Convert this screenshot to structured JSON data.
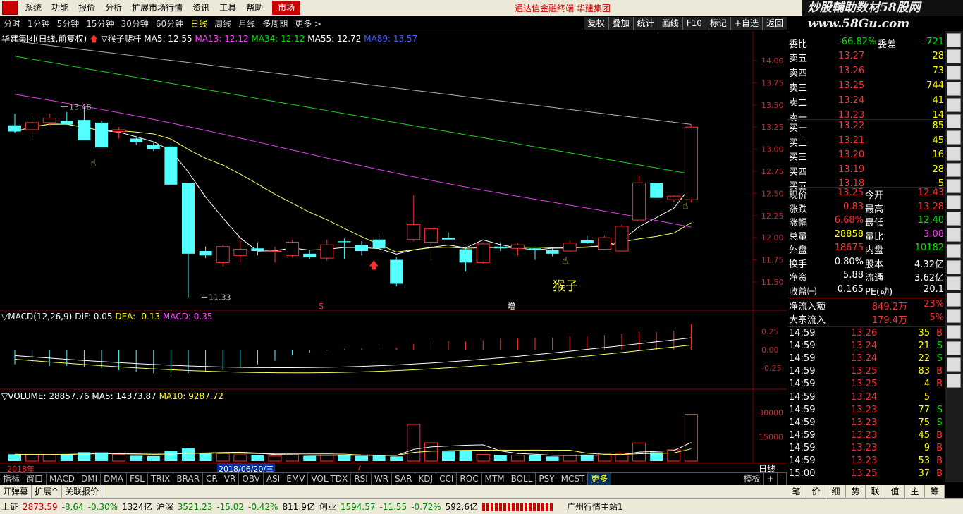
{
  "menu": {
    "items": [
      "系统",
      "功能",
      "报价",
      "分析",
      "扩展市场行情",
      "资讯",
      "工具",
      "帮助"
    ],
    "market": "市场",
    "center_title": "通达信金融终端 华建集团",
    "watermark": "炒股輔助数材58股网 www.58Gu.com"
  },
  "toolbar": {
    "periods": [
      "分时",
      "1分钟",
      "5分钟",
      "15分钟",
      "30分钟",
      "60分钟",
      "日线",
      "周线",
      "月线",
      "多周期",
      "更多 >"
    ],
    "active": "日线",
    "right_buttons": [
      "复权",
      "叠加",
      "统计",
      "画线",
      "F10",
      "标记",
      "+自选",
      "返回"
    ]
  },
  "info": {
    "title": "华建集团(日线,前复权)",
    "indicator": "▽猴子爬杆",
    "ma5": "MA5: 12.55",
    "ma13": "MA13: 12.12",
    "ma34": "MA34: 12.12",
    "ma55": "MA55: 12.72",
    "ma89": "MA89: 13.57"
  },
  "price_axis": [
    "14.00",
    "13.75",
    "13.50",
    "13.25",
    "13.00",
    "12.75",
    "12.50",
    "12.25",
    "12.00",
    "11.75",
    "11.50"
  ],
  "annotations": {
    "high": "13.48",
    "low": "11.33",
    "monkey": "猴子",
    "s_mark": "S",
    "add_mark": "增"
  },
  "macd": {
    "label": "▽MACD(12,26,9)",
    "dif": "DIF: 0.05",
    "dea": "DEA: -0.13",
    "macd": "MACD: 0.35",
    "axis": [
      "0.25",
      "0.00",
      "-0.25"
    ]
  },
  "volume": {
    "label": "▽VOLUME: 28857.76",
    "ma5": "MA5: 14373.87",
    "ma10": "MA10: 9287.72",
    "axis": [
      "30000",
      "15000"
    ]
  },
  "dates": {
    "year": "2018年",
    "cursor": "2018/06/20/三",
    "month": "7",
    "period_btn": "日线"
  },
  "chart_data": {
    "type": "candlestick",
    "ohlc": [
      [
        13.27,
        13.4,
        13.18,
        13.2
      ],
      [
        13.22,
        13.38,
        13.1,
        13.3
      ],
      [
        13.3,
        13.4,
        13.27,
        13.35
      ],
      [
        13.32,
        13.42,
        13.28,
        13.28
      ],
      [
        13.33,
        13.48,
        13.1,
        13.1
      ],
      [
        13.3,
        13.32,
        13.02,
        13.02
      ],
      [
        13.2,
        13.25,
        13.12,
        13.22
      ],
      [
        13.12,
        13.15,
        13.05,
        13.08
      ],
      [
        13.05,
        13.08,
        12.98,
        13.0
      ],
      [
        13.03,
        13.05,
        12.6,
        12.6
      ],
      [
        12.62,
        12.62,
        11.33,
        11.82
      ],
      [
        11.85,
        11.9,
        11.77,
        11.8
      ],
      [
        11.72,
        11.92,
        11.68,
        11.9
      ],
      [
        11.8,
        11.97,
        11.72,
        11.87
      ],
      [
        11.88,
        11.95,
        11.8,
        11.85
      ],
      [
        11.85,
        11.9,
        11.72,
        11.85
      ],
      [
        11.8,
        11.98,
        11.78,
        11.95
      ],
      [
        11.82,
        11.86,
        11.76,
        11.78
      ],
      [
        11.77,
        11.98,
        11.74,
        11.92
      ],
      [
        11.96,
        11.99,
        11.76,
        11.95
      ],
      [
        11.92,
        11.96,
        11.8,
        11.85
      ],
      [
        11.98,
        12.05,
        11.86,
        11.88
      ],
      [
        11.75,
        11.78,
        11.45,
        11.48
      ],
      [
        11.98,
        12.48,
        11.96,
        12.15
      ],
      [
        11.95,
        12.1,
        11.75,
        12.1
      ],
      [
        12.0,
        12.06,
        11.98,
        11.98
      ],
      [
        11.87,
        11.9,
        11.62,
        11.72
      ],
      [
        11.72,
        11.95,
        11.7,
        11.93
      ],
      [
        11.9,
        11.95,
        11.85,
        11.88
      ],
      [
        11.88,
        11.94,
        11.8,
        11.92
      ],
      [
        11.88,
        11.88,
        11.75,
        11.86
      ],
      [
        11.86,
        11.88,
        11.79,
        11.82
      ],
      [
        11.85,
        11.97,
        11.84,
        11.94
      ],
      [
        11.97,
        12.02,
        11.93,
        11.94
      ],
      [
        11.87,
        12.02,
        11.86,
        12.0
      ],
      [
        11.85,
        12.15,
        11.85,
        12.13
      ],
      [
        12.2,
        12.7,
        12.2,
        12.62
      ],
      [
        12.62,
        12.62,
        12.45,
        12.45
      ],
      [
        12.43,
        12.48,
        12.4,
        12.47
      ],
      [
        12.43,
        13.28,
        12.4,
        13.25
      ]
    ],
    "volume": [
      4200,
      4000,
      3900,
      4400,
      5500,
      5400,
      4000,
      3300,
      3100,
      6200,
      7800,
      4900,
      4600,
      3900,
      3700,
      3100,
      3900,
      3200,
      3700,
      3900,
      3200,
      3700,
      2900,
      22600,
      11300,
      6000,
      6200,
      4100,
      3800,
      3600,
      3600,
      2900,
      3500,
      4000,
      4400,
      4800,
      11200,
      5500,
      7000,
      28858
    ],
    "macd_hist": [
      -0.2,
      -0.22,
      -0.22,
      -0.22,
      -0.23,
      -0.25,
      -0.28,
      -0.3,
      -0.32,
      -0.32,
      -0.32,
      -0.3,
      -0.28,
      -0.24,
      -0.2,
      -0.15,
      -0.08,
      -0.04,
      -0.01,
      0.01,
      0.02,
      0.03,
      0.03,
      0.08,
      0.1,
      0.12,
      0.11,
      0.13,
      0.15,
      0.15,
      0.16,
      0.16,
      0.18,
      0.18,
      0.2,
      0.22,
      0.24,
      0.24,
      0.26,
      0.35
    ]
  },
  "orderbook": {
    "committee": {
      "label": "委比",
      "ratio": "-66.82%",
      "diff_label": "委差",
      "diff": "-721"
    },
    "sell": [
      {
        "l": "卖五",
        "p": "13.27",
        "v": "28"
      },
      {
        "l": "卖四",
        "p": "13.26",
        "v": "73"
      },
      {
        "l": "卖三",
        "p": "13.25",
        "v": "744"
      },
      {
        "l": "卖二",
        "p": "13.24",
        "v": "41"
      },
      {
        "l": "卖一",
        "p": "13.23",
        "v": "14"
      }
    ],
    "buy": [
      {
        "l": "买一",
        "p": "13.22",
        "v": "85"
      },
      {
        "l": "买二",
        "p": "13.21",
        "v": "45"
      },
      {
        "l": "买三",
        "p": "13.20",
        "v": "16"
      },
      {
        "l": "买四",
        "p": "13.19",
        "v": "28"
      },
      {
        "l": "买五",
        "p": "13.18",
        "v": "5"
      }
    ]
  },
  "quote": [
    {
      "l1": "现价",
      "v1": "13.25",
      "l2": "今开",
      "v2": "12.43",
      "c1": "red",
      "c2": "red"
    },
    {
      "l1": "涨跌",
      "v1": "0.83",
      "l2": "最高",
      "v2": "13.28",
      "c1": "red",
      "c2": "red"
    },
    {
      "l1": "涨幅",
      "v1": "6.68%",
      "l2": "最低",
      "v2": "12.40",
      "c1": "red",
      "c2": "green"
    },
    {
      "l1": "总量",
      "v1": "28858",
      "l2": "量比",
      "v2": "3.08",
      "c1": "yellow",
      "c2": "magenta"
    },
    {
      "l1": "外盘",
      "v1": "18675",
      "l2": "内盘",
      "v2": "10182",
      "c1": "red",
      "c2": "green"
    },
    {
      "l1": "换手",
      "v1": "0.80%",
      "l2": "股本",
      "v2": "4.32亿",
      "c1": "white",
      "c2": "white"
    },
    {
      "l1": "净资",
      "v1": "5.88",
      "l2": "流通",
      "v2": "3.62亿",
      "c1": "white",
      "c2": "white"
    },
    {
      "l1": "收益㈠",
      "v1": "0.165",
      "l2": "PE(动)",
      "v2": "20.1",
      "c1": "white",
      "c2": "white"
    }
  ],
  "flow": [
    {
      "l": "净流入额",
      "v": "849.2万",
      "p": "23%"
    },
    {
      "l": "大宗流入",
      "v": "179.4万",
      "p": "5%"
    }
  ],
  "ticks": [
    [
      "14:59",
      "13.26",
      "35",
      "B"
    ],
    [
      "14:59",
      "13.24",
      "21",
      "S"
    ],
    [
      "14:59",
      "13.24",
      "22",
      "S"
    ],
    [
      "14:59",
      "13.25",
      "83",
      "B"
    ],
    [
      "14:59",
      "13.25",
      "4",
      "B"
    ],
    [
      "14:59",
      "13.24",
      "5",
      ""
    ],
    [
      "14:59",
      "13.23",
      "77",
      "S"
    ],
    [
      "14:59",
      "13.23",
      "75",
      "S"
    ],
    [
      "14:59",
      "13.23",
      "45",
      "B"
    ],
    [
      "14:59",
      "13.23",
      "9",
      "B"
    ],
    [
      "14:59",
      "13.23",
      "53",
      "B"
    ],
    [
      "15:00",
      "13.25",
      "37",
      "B"
    ]
  ],
  "indicator_tabs": [
    "指标",
    "窗口",
    "MACD",
    "DMI",
    "DMA",
    "FSL",
    "TRIX",
    "BRAR",
    "CR",
    "VR",
    "OBV",
    "ASI",
    "EMV",
    "VOL-TDX",
    "RSI",
    "WR",
    "SAR",
    "KDJ",
    "CCI",
    "ROC",
    "MTM",
    "BOLL",
    "PSY",
    "MCST",
    "更多"
  ],
  "indicator_right": [
    "模板",
    "+",
    "-"
  ],
  "subbar": [
    "开弹幕",
    "扩展^",
    "关联报价"
  ],
  "right_tabs": [
    "笔",
    "价",
    "细",
    "势",
    "联",
    "值",
    "主",
    "筹"
  ],
  "status": {
    "sh": "上证",
    "sh_v": "2873.59",
    "sh_c": "-8.64",
    "sh_p": "-0.30%",
    "sh_a": "1324亿",
    "sz": "沪深",
    "sz_v": "3521.23",
    "sz_c": "-15.02",
    "sz_p": "-0.42%",
    "sz_a": "811.9亿",
    "cy": "创业",
    "cy_v": "1594.57",
    "cy_c": "-11.55",
    "cy_p": "-0.72%",
    "cy_a": "592.6亿",
    "server": "广州行情主站1"
  }
}
